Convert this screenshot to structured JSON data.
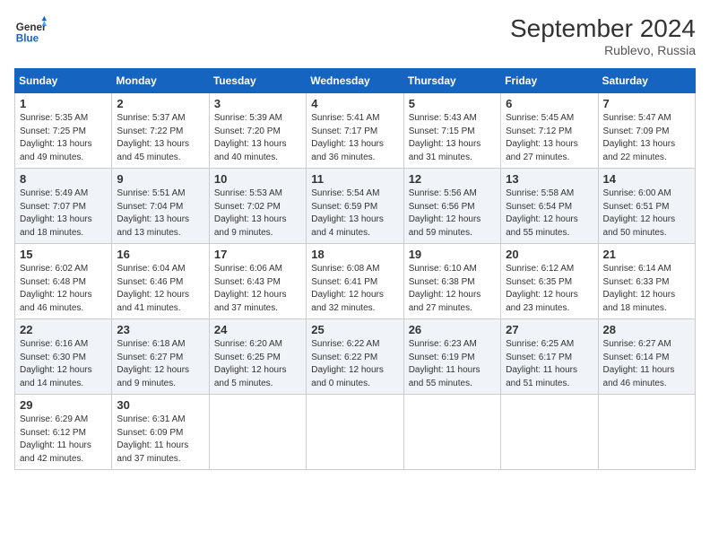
{
  "header": {
    "logo_line1": "General",
    "logo_line2": "Blue",
    "month_year": "September 2024",
    "location": "Rublevo, Russia"
  },
  "days_of_week": [
    "Sunday",
    "Monday",
    "Tuesday",
    "Wednesday",
    "Thursday",
    "Friday",
    "Saturday"
  ],
  "weeks": [
    [
      {
        "day": "1",
        "info": "Sunrise: 5:35 AM\nSunset: 7:25 PM\nDaylight: 13 hours\nand 49 minutes."
      },
      {
        "day": "2",
        "info": "Sunrise: 5:37 AM\nSunset: 7:22 PM\nDaylight: 13 hours\nand 45 minutes."
      },
      {
        "day": "3",
        "info": "Sunrise: 5:39 AM\nSunset: 7:20 PM\nDaylight: 13 hours\nand 40 minutes."
      },
      {
        "day": "4",
        "info": "Sunrise: 5:41 AM\nSunset: 7:17 PM\nDaylight: 13 hours\nand 36 minutes."
      },
      {
        "day": "5",
        "info": "Sunrise: 5:43 AM\nSunset: 7:15 PM\nDaylight: 13 hours\nand 31 minutes."
      },
      {
        "day": "6",
        "info": "Sunrise: 5:45 AM\nSunset: 7:12 PM\nDaylight: 13 hours\nand 27 minutes."
      },
      {
        "day": "7",
        "info": "Sunrise: 5:47 AM\nSunset: 7:09 PM\nDaylight: 13 hours\nand 22 minutes."
      }
    ],
    [
      {
        "day": "8",
        "info": "Sunrise: 5:49 AM\nSunset: 7:07 PM\nDaylight: 13 hours\nand 18 minutes."
      },
      {
        "day": "9",
        "info": "Sunrise: 5:51 AM\nSunset: 7:04 PM\nDaylight: 13 hours\nand 13 minutes."
      },
      {
        "day": "10",
        "info": "Sunrise: 5:53 AM\nSunset: 7:02 PM\nDaylight: 13 hours\nand 9 minutes."
      },
      {
        "day": "11",
        "info": "Sunrise: 5:54 AM\nSunset: 6:59 PM\nDaylight: 13 hours\nand 4 minutes."
      },
      {
        "day": "12",
        "info": "Sunrise: 5:56 AM\nSunset: 6:56 PM\nDaylight: 12 hours\nand 59 minutes."
      },
      {
        "day": "13",
        "info": "Sunrise: 5:58 AM\nSunset: 6:54 PM\nDaylight: 12 hours\nand 55 minutes."
      },
      {
        "day": "14",
        "info": "Sunrise: 6:00 AM\nSunset: 6:51 PM\nDaylight: 12 hours\nand 50 minutes."
      }
    ],
    [
      {
        "day": "15",
        "info": "Sunrise: 6:02 AM\nSunset: 6:48 PM\nDaylight: 12 hours\nand 46 minutes."
      },
      {
        "day": "16",
        "info": "Sunrise: 6:04 AM\nSunset: 6:46 PM\nDaylight: 12 hours\nand 41 minutes."
      },
      {
        "day": "17",
        "info": "Sunrise: 6:06 AM\nSunset: 6:43 PM\nDaylight: 12 hours\nand 37 minutes."
      },
      {
        "day": "18",
        "info": "Sunrise: 6:08 AM\nSunset: 6:41 PM\nDaylight: 12 hours\nand 32 minutes."
      },
      {
        "day": "19",
        "info": "Sunrise: 6:10 AM\nSunset: 6:38 PM\nDaylight: 12 hours\nand 27 minutes."
      },
      {
        "day": "20",
        "info": "Sunrise: 6:12 AM\nSunset: 6:35 PM\nDaylight: 12 hours\nand 23 minutes."
      },
      {
        "day": "21",
        "info": "Sunrise: 6:14 AM\nSunset: 6:33 PM\nDaylight: 12 hours\nand 18 minutes."
      }
    ],
    [
      {
        "day": "22",
        "info": "Sunrise: 6:16 AM\nSunset: 6:30 PM\nDaylight: 12 hours\nand 14 minutes."
      },
      {
        "day": "23",
        "info": "Sunrise: 6:18 AM\nSunset: 6:27 PM\nDaylight: 12 hours\nand 9 minutes."
      },
      {
        "day": "24",
        "info": "Sunrise: 6:20 AM\nSunset: 6:25 PM\nDaylight: 12 hours\nand 5 minutes."
      },
      {
        "day": "25",
        "info": "Sunrise: 6:22 AM\nSunset: 6:22 PM\nDaylight: 12 hours\nand 0 minutes."
      },
      {
        "day": "26",
        "info": "Sunrise: 6:23 AM\nSunset: 6:19 PM\nDaylight: 11 hours\nand 55 minutes."
      },
      {
        "day": "27",
        "info": "Sunrise: 6:25 AM\nSunset: 6:17 PM\nDaylight: 11 hours\nand 51 minutes."
      },
      {
        "day": "28",
        "info": "Sunrise: 6:27 AM\nSunset: 6:14 PM\nDaylight: 11 hours\nand 46 minutes."
      }
    ],
    [
      {
        "day": "29",
        "info": "Sunrise: 6:29 AM\nSunset: 6:12 PM\nDaylight: 11 hours\nand 42 minutes."
      },
      {
        "day": "30",
        "info": "Sunrise: 6:31 AM\nSunset: 6:09 PM\nDaylight: 11 hours\nand 37 minutes."
      },
      {
        "day": "",
        "info": ""
      },
      {
        "day": "",
        "info": ""
      },
      {
        "day": "",
        "info": ""
      },
      {
        "day": "",
        "info": ""
      },
      {
        "day": "",
        "info": ""
      }
    ]
  ]
}
